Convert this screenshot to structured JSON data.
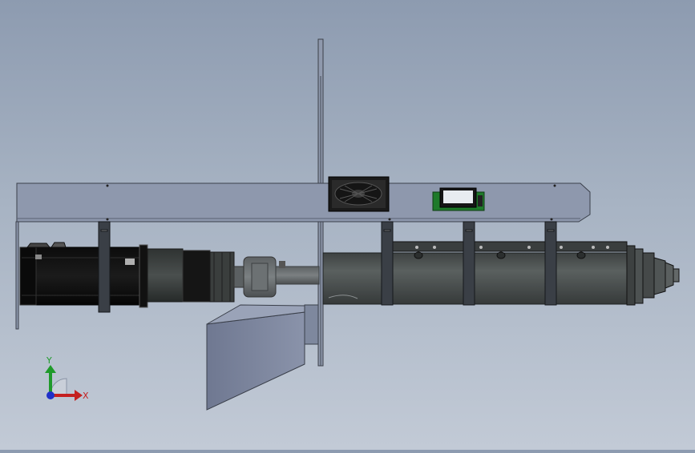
{
  "axes": {
    "y_label": "Y",
    "x_label": "X",
    "colors": {
      "y": "#1f9a2a",
      "x": "#c42020",
      "z": "#2030c8"
    }
  },
  "icons": [
    "fan-icon",
    "controller-board-icon",
    "motor-icon",
    "hopper-icon",
    "extruder-barrel-icon"
  ],
  "colors": {
    "background_top": "#8d9bb0",
    "background_bottom": "#c2cad6",
    "plate": "#8e98ad",
    "barrel": "#4b504f",
    "motor": "#111111",
    "board_green": "#1e7a2a"
  }
}
